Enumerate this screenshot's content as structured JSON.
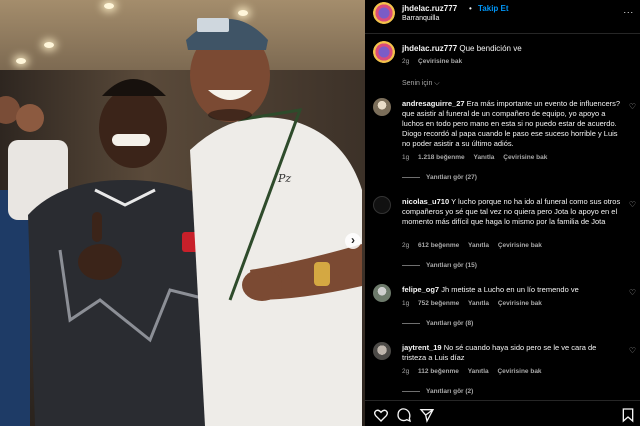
{
  "header": {
    "username": "jhdelac.ruz777",
    "follow_label": "Takip Et",
    "separator": "•",
    "location": "Barranquilla",
    "more": "..."
  },
  "post_caption": {
    "username": "jhdelac.ruz777",
    "text": "Que bendición ve",
    "time": "2g",
    "translate": "Çevirisine bak"
  },
  "sort_label": "Senin için ⌵",
  "comments": [
    {
      "username": "andresaguirre_27",
      "text": "Era más importante un evento de influencers? que asistir al funeral de un compañero de equipo, yo apoyo a luchos en todo pero mano en esta si no puedo estar de acuerdo. Diogo recordó al papa cuando le paso ese suceso horrible y Luis no poder asistir a su último adiós.",
      "time": "1g",
      "likes": "1.218 beğenme",
      "reply": "Yanıtla",
      "translate": "Çevirisine bak",
      "replies": "Yanıtları gör (27)"
    },
    {
      "username": "nicolas_u710",
      "text": "Y lucho porque no ha ido al funeral como sus otros compañeros yo sé que tal vez no quiera pero Jota lo apoyo en el momento más difícil que haga lo mismo por la familia de Jota",
      "time": "2g",
      "likes": "612 beğenme",
      "reply": "Yanıtla",
      "translate": "Çevirisine bak",
      "replies": "Yanıtları gör (15)"
    },
    {
      "username": "felipe_og7",
      "text": "Jh metiste a Lucho en un lío tremendo ve",
      "time": "1g",
      "likes": "752 beğenme",
      "reply": "Yanıtla",
      "translate": "Çevirisine bak",
      "replies": "Yanıtları gör (8)"
    },
    {
      "username": "jaytrent_19",
      "text": "No sé cuando haya sido pero se le ve cara de tristeza a Luis díaz",
      "time": "2g",
      "likes": "112 beğenme",
      "reply": "Yanıtla",
      "translate": "Çevirisine bak",
      "replies": "Yanıtları gör (2)"
    }
  ],
  "icons": {
    "like": "heart-icon",
    "comment": "comment-icon",
    "share": "share-icon",
    "save": "bookmark-icon",
    "carousel_next": "chevron-right-icon"
  },
  "carousel_next_glyph": "›",
  "colors": {
    "background": "#000000",
    "link": "#0095f6",
    "muted": "#a8a8a8"
  }
}
